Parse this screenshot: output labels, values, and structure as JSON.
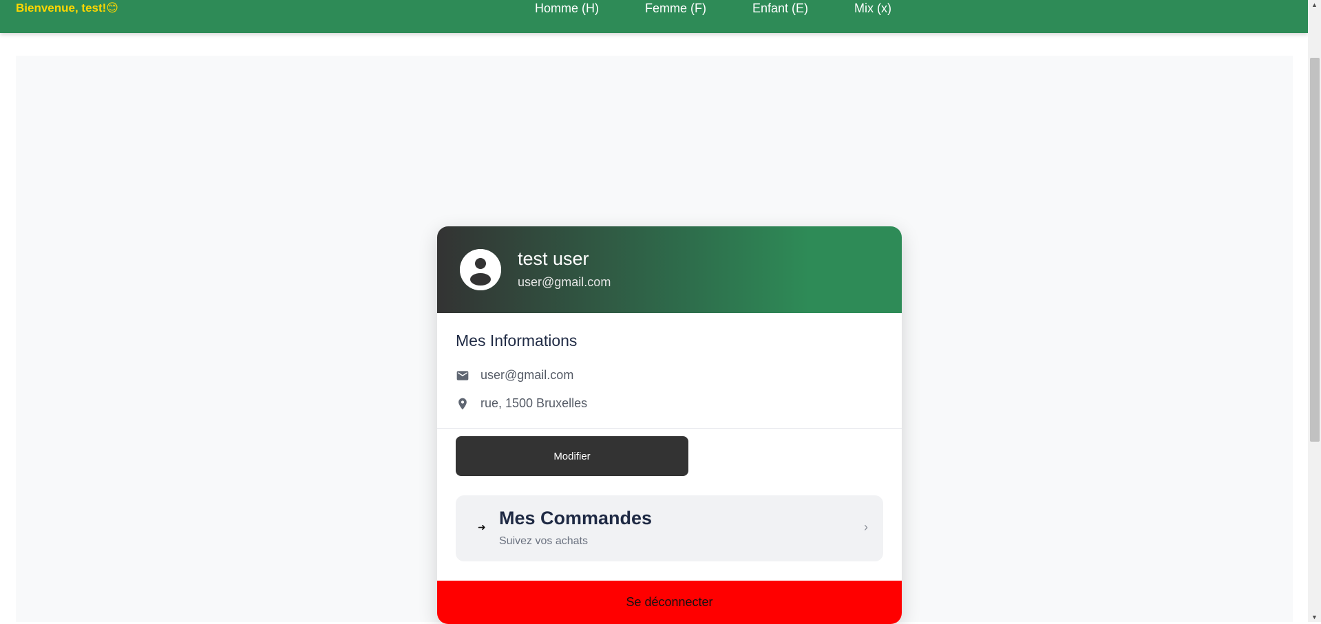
{
  "header": {
    "greeting": "Bienvenue, test!😊",
    "nav": [
      "Homme (H)",
      "Femme (F)",
      "Enfant (E)",
      "Mix (x)"
    ]
  },
  "profile": {
    "name": "test user",
    "email": "user@gmail.com",
    "avatar_icon": "user-circle-icon"
  },
  "info": {
    "title": "Mes Informations",
    "email": "user@gmail.com",
    "address": "rue, 1500 Bruxelles",
    "email_icon": "mail-icon",
    "address_icon": "location-pin-icon"
  },
  "actions": {
    "edit_label": "Modifier",
    "logout_label": "Se déconnecter"
  },
  "orders": {
    "title": "Mes Commandes",
    "subtitle": "Suivez vos achats",
    "arrow": "➜",
    "chevron": "›"
  },
  "scrollbar": {
    "up": "▲",
    "down": "▼"
  },
  "colors": {
    "topbar": "#2e8b57",
    "brand": "#ffd700",
    "edit_button": "#333333",
    "logout_button": "#ff0000"
  }
}
